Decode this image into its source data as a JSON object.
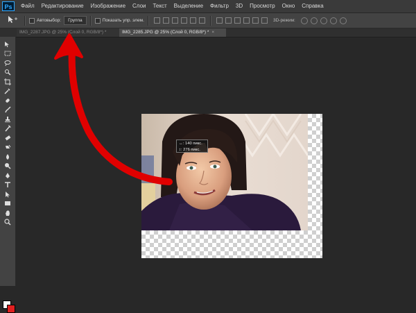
{
  "app": {
    "logo": "Ps"
  },
  "menu": [
    "Файл",
    "Редактирование",
    "Изображение",
    "Слои",
    "Текст",
    "Выделение",
    "Фильтр",
    "3D",
    "Просмотр",
    "Окно",
    "Справка"
  ],
  "options": {
    "tool_icon": "move-tool-icon",
    "autoselect_label": "Автовыбор:",
    "autoselect_value": "Группа",
    "show_transform_label": "Показать упр. элем.",
    "mode_3d_label": "3D-режим:"
  },
  "tabs": [
    {
      "label": "IMG_2287.JPG @ 25% (Слой 0, RGB/8*) *",
      "active": false
    },
    {
      "label": "IMG_2285.JPG @ 25% (Слой 0, RGB/8*) *",
      "active": true
    }
  ],
  "tools": [
    "move-tool-icon",
    "marquee-icon",
    "lasso-icon",
    "quick-select-icon",
    "crop-icon",
    "eyedropper-icon",
    "healing-brush-icon",
    "brush-icon",
    "clone-stamp-icon",
    "history-brush-icon",
    "eraser-icon",
    "gradient-icon",
    "blur-icon",
    "dodge-icon",
    "pen-icon",
    "type-icon",
    "path-select-icon",
    "rectangle-icon",
    "hand-icon",
    "zoom-icon"
  ],
  "tooltip": {
    "width": "140 пикс.",
    "height": "276 пикс."
  },
  "colors": {
    "foreground": "#ffffff",
    "background": "#e02020",
    "annotation_arrow": "#e00000"
  }
}
